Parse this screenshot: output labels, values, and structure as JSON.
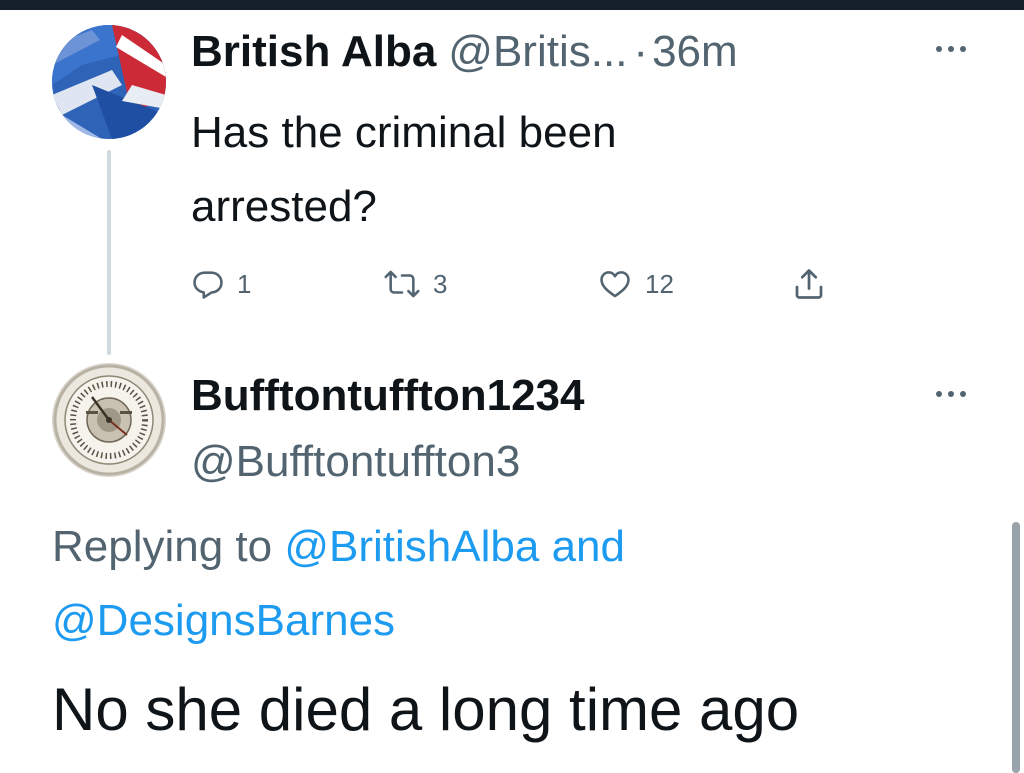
{
  "tweet1": {
    "display_name": "British Alba",
    "handle": "@Britis...",
    "separator": "·",
    "time": "36m",
    "text": "Has the criminal been arrested?",
    "reply_count": "1",
    "retweet_count": "3",
    "like_count": "12"
  },
  "tweet2": {
    "display_name": "Bufftontuffton1234",
    "handle": "@Bufftontuffton3",
    "replying_prefix": "Replying to ",
    "replying_mention1": "@BritishAlba",
    "replying_and": " and ",
    "replying_mention2": "@DesignsBarnes",
    "text": "No she died a long time ago"
  },
  "colors": {
    "primary_text": "#0f1419",
    "secondary_text": "#536471",
    "accent_link": "#1d9bf0",
    "thread_line": "#cfd9de"
  },
  "icons": {
    "reply": "speech-bubble-icon",
    "retweet": "retweet-arrows-icon",
    "like": "heart-icon",
    "share": "share-upload-icon",
    "more": "more-dots-icon"
  }
}
